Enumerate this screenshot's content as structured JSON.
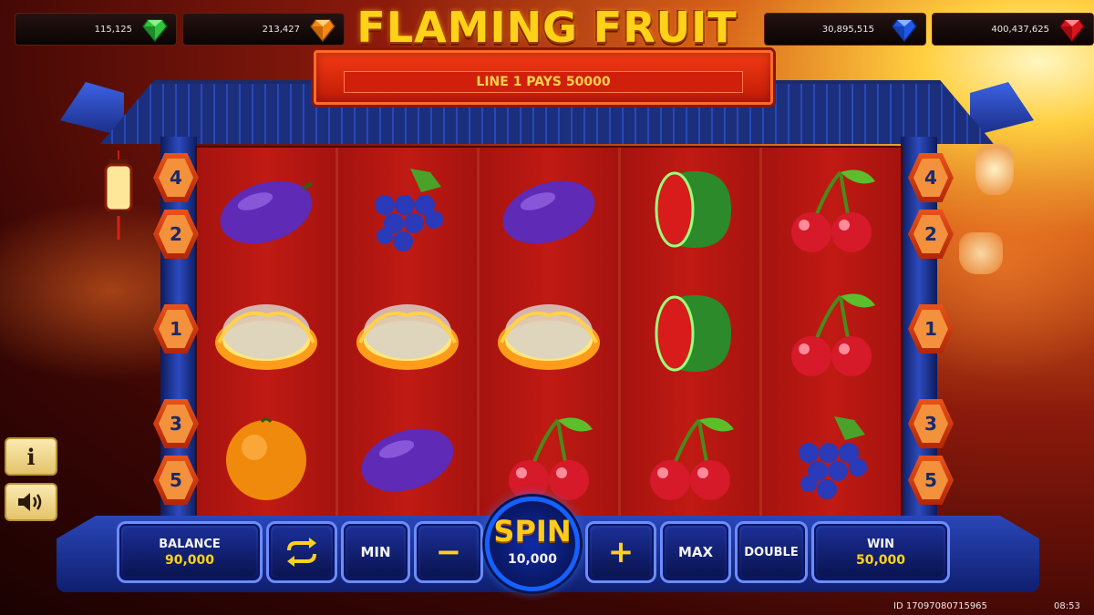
{
  "jackpots": [
    {
      "value": "115,125",
      "gem": "green-gem-icon",
      "color": "#2fc43c"
    },
    {
      "value": "213,427",
      "gem": "orange-gem-icon",
      "color": "#f58a12"
    },
    {
      "value": "30,895,515",
      "gem": "blue-gem-icon",
      "color": "#1f58e8"
    },
    {
      "value": "400,437,625",
      "gem": "red-gem-icon",
      "color": "#d8141c"
    }
  ],
  "title": "FLAMING FRUIT",
  "message": "LINE 1 PAYS 50000",
  "paylines_left": [
    "4",
    "2",
    "1",
    "3",
    "5"
  ],
  "paylines_right": [
    "4",
    "2",
    "1",
    "3",
    "5"
  ],
  "reels": [
    [
      "plum",
      "flaming-fire",
      "orange"
    ],
    [
      "grapes",
      "flaming-fire",
      "plum"
    ],
    [
      "plum",
      "flaming-fire",
      "cherries"
    ],
    [
      "watermelon",
      "watermelon",
      "cherries"
    ],
    [
      "cherries",
      "cherries",
      "grapes"
    ]
  ],
  "controls": {
    "balance_label": "BALANCE",
    "balance_value": "90,000",
    "autoplay_icon": "repeat-icon",
    "min_label": "MIN",
    "minus_label": "−",
    "spin_label": "SPIN",
    "bet_value": "10,000",
    "plus_label": "+",
    "max_label": "MAX",
    "double_label": "DOUBLE",
    "win_label": "WIN",
    "win_value": "50,000"
  },
  "side_buttons": [
    {
      "name": "info",
      "label": "i"
    },
    {
      "name": "sound",
      "icon": "speaker-icon"
    }
  ],
  "footer": {
    "id": "ID 17097080715965",
    "time": "08:53"
  }
}
